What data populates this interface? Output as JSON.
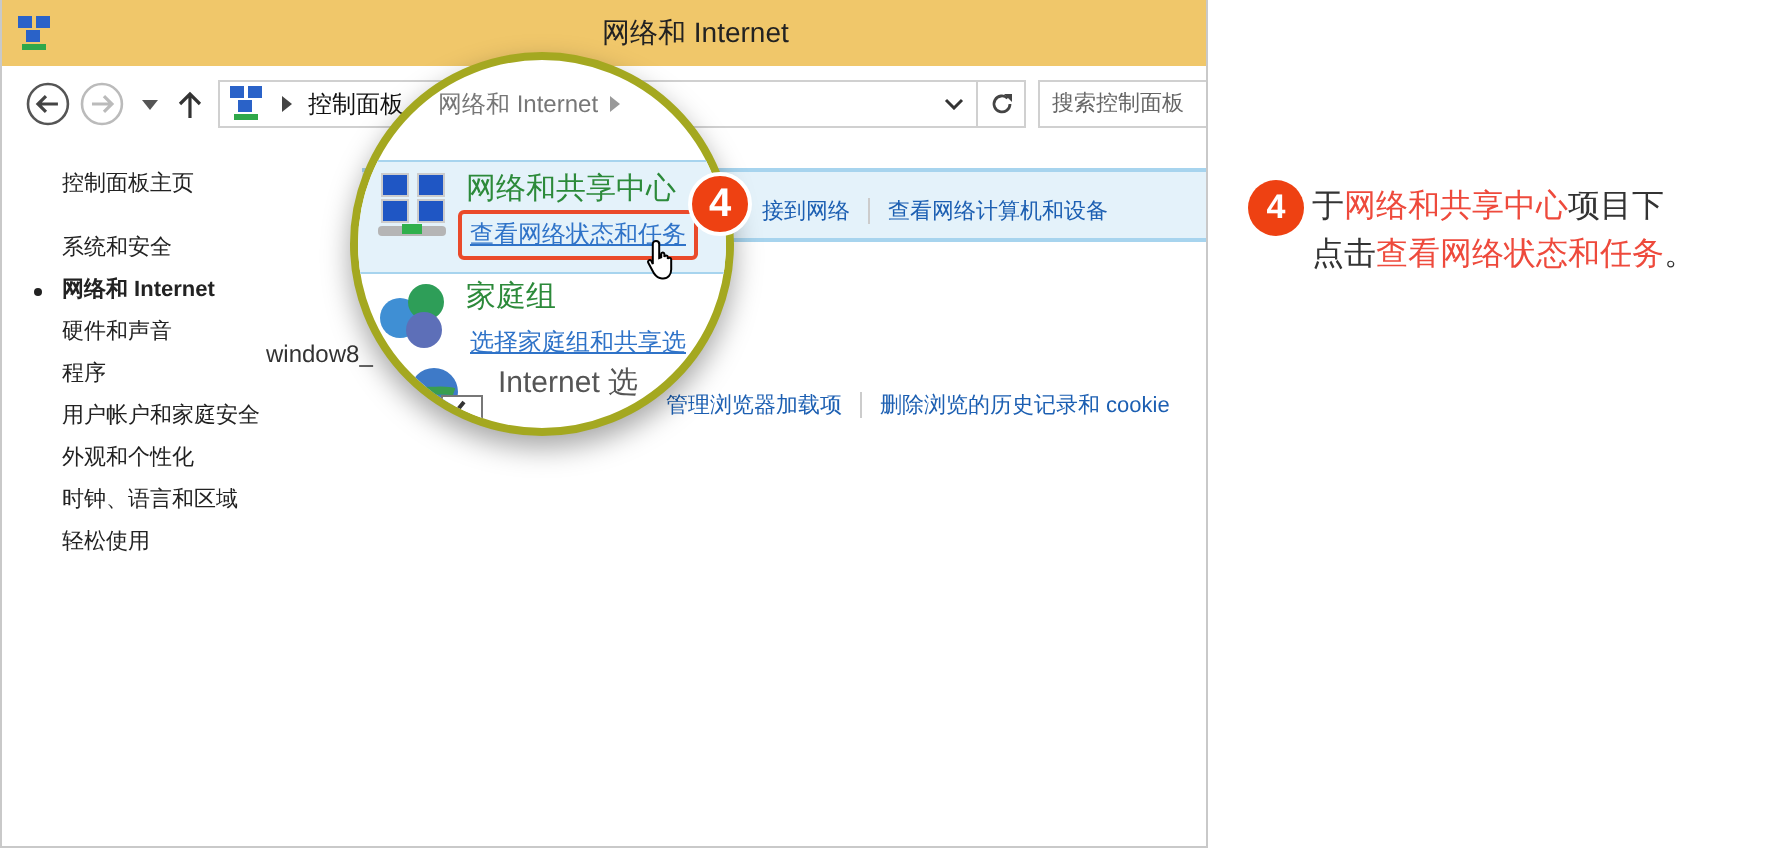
{
  "window": {
    "title": "网络和 Internet"
  },
  "address_bar": {
    "breadcrumb": [
      "控制面板"
    ],
    "search_placeholder": "搜索控制面板"
  },
  "sidebar": {
    "home": "控制面板主页",
    "items": [
      {
        "label": "系统和安全",
        "selected": false
      },
      {
        "label": "网络和 Internet",
        "selected": true
      },
      {
        "label": "硬件和声音",
        "selected": false
      },
      {
        "label": "程序",
        "selected": false
      },
      {
        "label": "用户帐户和家庭安全",
        "selected": false
      },
      {
        "label": "外观和个性化",
        "selected": false
      },
      {
        "label": "时钟、语言和区域",
        "selected": false
      },
      {
        "label": "轻松使用",
        "selected": false
      }
    ]
  },
  "content": {
    "network_links": [
      "接到网络",
      "查看网络计算机和设备"
    ],
    "internet_links": [
      "管理浏览器加载项",
      "删除浏览的历史记录和 cookie"
    ]
  },
  "caption": "window8_",
  "magnifier": {
    "breadcrumb": "网络和 Internet",
    "items": [
      {
        "kind": "network",
        "title": "网络和共享中心",
        "link": "查看网络状态和任务",
        "framed": true
      },
      {
        "kind": "homegroup",
        "title": "家庭组",
        "link": "选择家庭组和共享选",
        "framed": false
      },
      {
        "kind": "internet",
        "title": "Internet 选",
        "framed": false
      }
    ],
    "badge_number": "4"
  },
  "step": {
    "number": "4",
    "lines": [
      "于**网络和共享中心**项目下",
      "点击**查看网络状态和任务**。"
    ]
  }
}
